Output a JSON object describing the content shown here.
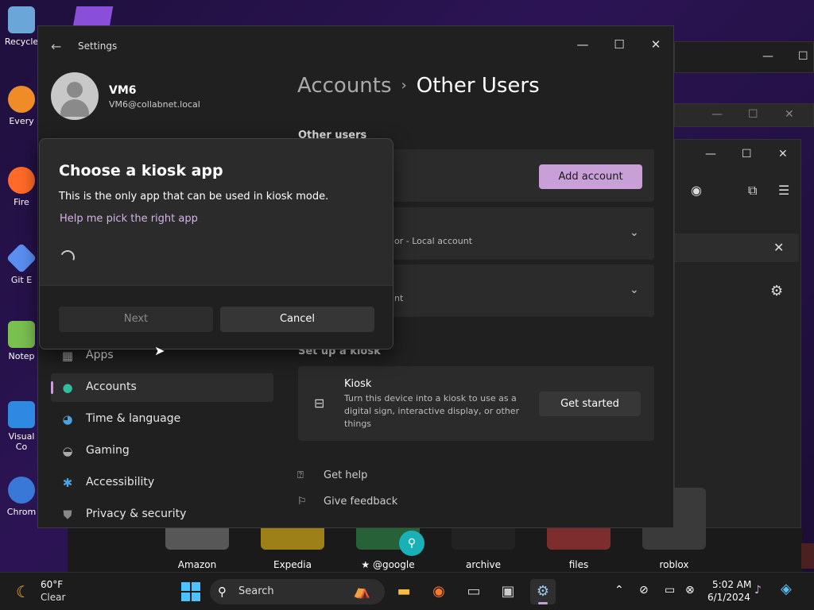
{
  "desktop": {
    "icons": [
      {
        "label": "Recycle",
        "color": "#6aa6d8"
      },
      {
        "label": "Every",
        "color": "#f08c28"
      },
      {
        "label": "Fire",
        "color": "#ff6a28"
      },
      {
        "label": "Git E",
        "color": "#5a8ef0"
      },
      {
        "label": "Notep",
        "color": "#7ac050"
      },
      {
        "label": "Visual Co",
        "color": "#2d8ae0"
      },
      {
        "label": "Chrom",
        "color": "#3a78d8"
      }
    ]
  },
  "settings": {
    "title": "Settings",
    "profile": {
      "name": "VM6",
      "email": "VM6@collabnet.local"
    },
    "nav": [
      {
        "label": "Apps",
        "icon": "apps-icon",
        "active": false
      },
      {
        "label": "Accounts",
        "icon": "accounts-icon",
        "active": true
      },
      {
        "label": "Time & language",
        "icon": "globe-icon",
        "active": false
      },
      {
        "label": "Gaming",
        "icon": "gamepad-icon",
        "active": false
      },
      {
        "label": "Accessibility",
        "icon": "accessibility-icon",
        "active": false
      },
      {
        "label": "Privacy & security",
        "icon": "shield-icon",
        "active": false
      }
    ],
    "breadcrumb": {
      "parent": "Accounts",
      "separator": "›",
      "current": "Other Users"
    },
    "other_users": {
      "section_title": "Other users",
      "add_account_label": "Add account",
      "users": [
        {
          "subtitle": "or - Local account"
        },
        {
          "subtitle": "nt"
        }
      ]
    },
    "kiosk": {
      "section_title": "Set up a kiosk",
      "title": "Kiosk",
      "description": "Turn this device into a kiosk to use as a digital sign, interactive display, or other things",
      "button_label": "Get started"
    },
    "links": [
      {
        "label": "Get help"
      },
      {
        "label": "Give feedback"
      }
    ]
  },
  "dialog": {
    "title": "Choose a kiosk app",
    "description": "This is the only app that can be used in kiosk mode.",
    "help_link": "Help me pick the right app",
    "next_label": "Next",
    "cancel_label": "Cancel"
  },
  "store_tiles": [
    {
      "label": "Amazon",
      "color": "#e6e6e6"
    },
    {
      "label": "Expedia",
      "color": "#f5c518"
    },
    {
      "label": "★ @google",
      "color": "#34a853"
    },
    {
      "label": "archive",
      "color": "#222222"
    },
    {
      "label": "files",
      "color": "#e04040"
    },
    {
      "label": "roblox",
      "color": "#3a3a3a"
    }
  ],
  "taskbar": {
    "weather": {
      "temp": "60°F",
      "condition": "Clear"
    },
    "search_placeholder": "Search",
    "clock": {
      "time": "5:02 AM",
      "date": "6/1/2024"
    }
  },
  "colors": {
    "accent": "#c99fd8",
    "window_bg": "#202020",
    "card_bg": "#2b2b2b"
  }
}
